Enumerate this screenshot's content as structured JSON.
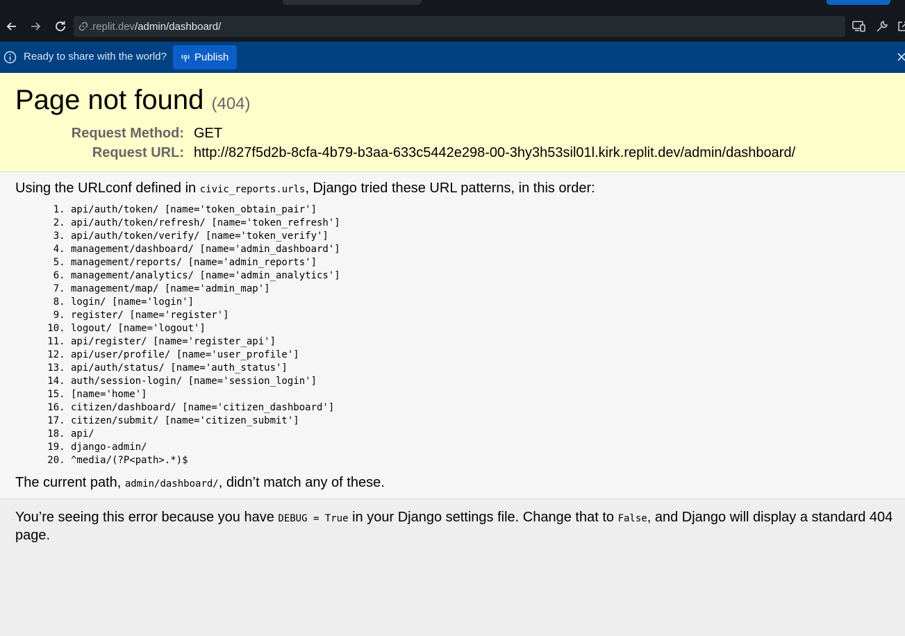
{
  "browser": {
    "url_dim": ".replit.dev",
    "url_path": "/admin/dashboard/",
    "icons": [
      "back-icon",
      "forward-icon",
      "reload-icon",
      "link-icon",
      "devices-icon",
      "wrench-icon",
      "external-icon"
    ]
  },
  "banner": {
    "message": "Ready to share with the world?",
    "publish_label": "Publish",
    "colors": {
      "background": "#004182",
      "button": "#0c5ec7"
    }
  },
  "error": {
    "title": "Page not found",
    "status": "(404)",
    "method_label": "Request Method:",
    "method_value": "GET",
    "url_label": "Request URL:",
    "url_value": "http://827f5d2b-8cfa-4b79-b3aa-633c5442e298-00-3hy3h53sil01l.kirk.replit.dev/admin/dashboard/"
  },
  "urlconf": {
    "intro_before": "Using the URLconf defined in ",
    "module": "civic_reports.urls",
    "intro_after": ", Django tried these URL patterns, in this order:",
    "patterns": [
      "api/auth/token/ [name='token_obtain_pair']",
      "api/auth/token/refresh/ [name='token_refresh']",
      "api/auth/token/verify/ [name='token_verify']",
      "management/dashboard/ [name='admin_dashboard']",
      "management/reports/ [name='admin_reports']",
      "management/analytics/ [name='admin_analytics']",
      "management/map/ [name='admin_map']",
      "login/ [name='login']",
      "register/ [name='register']",
      "logout/ [name='logout']",
      "api/register/ [name='register_api']",
      "api/user/profile/ [name='user_profile']",
      "api/auth/status/ [name='auth_status']",
      "auth/session-login/ [name='session_login']",
      "[name='home']",
      "citizen/dashboard/ [name='citizen_dashboard']",
      "citizen/submit/ [name='citizen_submit']",
      "api/",
      "django-admin/",
      "^media/(?P<path>.*)$"
    ],
    "current_before": "The current path, ",
    "current_path": "admin/dashboard/",
    "current_after": ", didn’t match any of these."
  },
  "explanation": {
    "part1": "You’re seeing this error because you have ",
    "code1": "DEBUG = True",
    "part2": " in your Django settings file. Change that to ",
    "code2": "False",
    "part3": ", and Django will display a standard 404 page."
  }
}
